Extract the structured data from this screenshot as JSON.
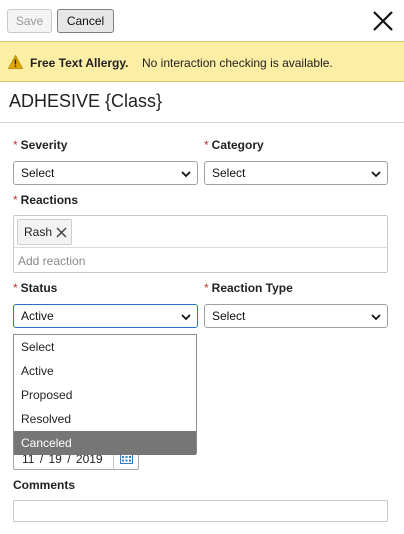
{
  "toolbar": {
    "save_label": "Save",
    "cancel_label": "Cancel",
    "close_icon": "close-icon"
  },
  "banner": {
    "icon": "warning-icon",
    "bold_text": "Free Text Allergy.",
    "text": "No interaction checking is available.",
    "background": "#fdeea6"
  },
  "title": "ADHESIVE {Class}",
  "fields": {
    "required_marker": "*",
    "severity": {
      "label": "Severity",
      "value": "Select"
    },
    "category": {
      "label": "Category",
      "value": "Select"
    },
    "reactions": {
      "label": "Reactions",
      "chips": [
        "Rash"
      ],
      "placeholder": "Add reaction"
    },
    "status": {
      "label": "Status",
      "value": "Active",
      "options": [
        "Select",
        "Active",
        "Proposed",
        "Resolved",
        "Canceled"
      ],
      "highlighted": "Canceled"
    },
    "reaction_type": {
      "label": "Reaction Type",
      "value": "Select"
    },
    "date": {
      "month": "11",
      "day": "19",
      "year": "2019",
      "separator": "/"
    },
    "comments": {
      "label": "Comments",
      "value": ""
    }
  },
  "colors": {
    "required": "#c0392b",
    "focus_border": "#2b72c6",
    "highlight": "#767676"
  }
}
